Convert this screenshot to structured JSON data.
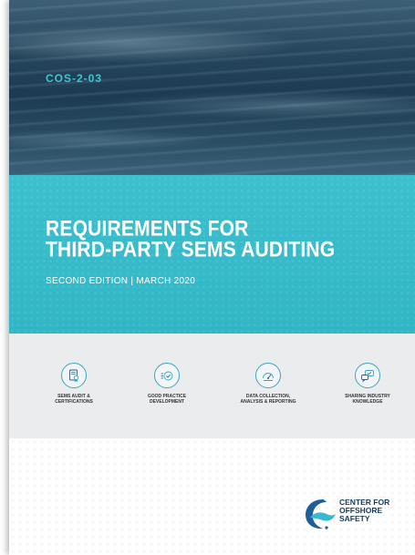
{
  "cover": {
    "code": "COS-2-03",
    "title_line1": "REQUIREMENTS FOR",
    "title_line2": "THIRD-PARTY SEMS AUDITING",
    "edition": "SECOND EDITION  |  MARCH 2020"
  },
  "pillars": [
    {
      "icon": "certificate-icon",
      "label_line1": "SEMS AUDIT &",
      "label_line2": "CERTIFICATIONS"
    },
    {
      "icon": "check-list-icon",
      "label_line1": "GOOD PRACTICE",
      "label_line2": "DEVELOPMENT"
    },
    {
      "icon": "gauge-icon",
      "label_line1": "DATA COLLECTION,",
      "label_line2": "ANALYSIS & REPORTING"
    },
    {
      "icon": "chat-bubbles-icon",
      "label_line1": "SHARING INDUSTRY",
      "label_line2": "KNOWLEDGE"
    }
  ],
  "logo": {
    "line1": "CENTER FOR",
    "line2": "OFFSHORE",
    "line3": "SAFETY"
  },
  "colors": {
    "teal": "#36bccb",
    "navy": "#163a5a",
    "icon_blue": "#3aa7c0",
    "ocean": "#1c3b52"
  }
}
